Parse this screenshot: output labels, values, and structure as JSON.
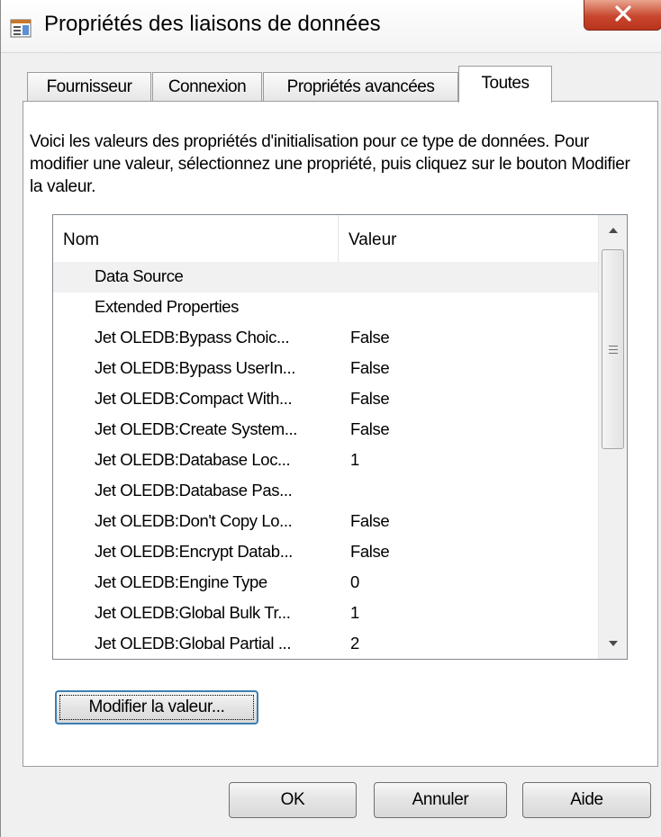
{
  "window": {
    "title": "Propriétés des liaisons de données",
    "icon": "properties-window-icon",
    "close_icon": "close-x-icon"
  },
  "tabs": [
    {
      "label": "Fournisseur",
      "active": false
    },
    {
      "label": "Connexion",
      "active": false
    },
    {
      "label": "Propriétés avancées",
      "active": false
    },
    {
      "label": "Toutes",
      "active": true
    }
  ],
  "description": "Voici les valeurs des propriétés d'initialisation pour ce type de données. Pour modifier une valeur, sélectionnez une propriété, puis cliquez sur le bouton Modifier la valeur.",
  "list": {
    "columns": {
      "name": "Nom",
      "value": "Valeur"
    },
    "rows": [
      {
        "name": "Data Source",
        "value": ""
      },
      {
        "name": "Extended Properties",
        "value": ""
      },
      {
        "name": "Jet OLEDB:Bypass Choic...",
        "value": "False"
      },
      {
        "name": "Jet OLEDB:Bypass UserIn...",
        "value": "False"
      },
      {
        "name": "Jet OLEDB:Compact With...",
        "value": "False"
      },
      {
        "name": "Jet OLEDB:Create System...",
        "value": "False"
      },
      {
        "name": "Jet OLEDB:Database Loc...",
        "value": "1"
      },
      {
        "name": "Jet OLEDB:Database Pas...",
        "value": ""
      },
      {
        "name": "Jet OLEDB:Don't Copy Lo...",
        "value": "False"
      },
      {
        "name": "Jet OLEDB:Encrypt Datab...",
        "value": "False"
      },
      {
        "name": "Jet OLEDB:Engine Type",
        "value": "0"
      },
      {
        "name": "Jet OLEDB:Global Bulk Tr...",
        "value": "1"
      },
      {
        "name": "Jet OLEDB:Global Partial ...",
        "value": "2"
      }
    ],
    "hovered_row": 0
  },
  "buttons": {
    "modify": "Modifier la valeur...",
    "ok": "OK",
    "cancel": "Annuler",
    "help": "Aide"
  },
  "colors": {
    "close_button": "#c8472f",
    "focus_border": "#3c7fb1"
  }
}
